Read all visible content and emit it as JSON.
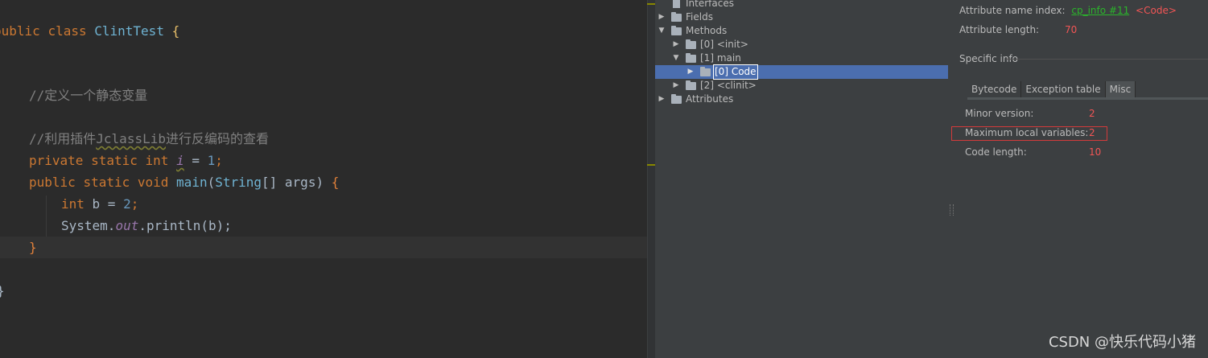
{
  "editor": {
    "lines": {
      "l1_kw1": "public",
      "l1_kw2": "class",
      "l1_cls": "ClintTest",
      "l1_brace": "{",
      "l2_comment": "//定义一个静态变量",
      "l3_comment_a": "//利用插件",
      "l3_comment_b": "JclassLib",
      "l3_comment_c": "进行反编码的查看",
      "l4_kw1": "private",
      "l4_kw2": "static",
      "l4_kw3": "int",
      "l4_var": "i",
      "l4_eq": " = ",
      "l4_num": "1",
      "l4_semi": ";",
      "l5_kw1": "public",
      "l5_kw2": "static",
      "l5_kw3": "void",
      "l5_fn": "main",
      "l5_paren": "(",
      "l5_type": "String",
      "l5_args": "[] args)",
      "l5_brace": "{",
      "l6_kw": "int",
      "l6_rest": " b = ",
      "l6_num": "2",
      "l6_semi": ";",
      "l7_sys": "System.",
      "l7_out": "out",
      "l7_call": ".println(b);",
      "l8_brace": "}",
      "l9_brace": "}"
    }
  },
  "tree": {
    "items": [
      {
        "label": "Interfaces"
      },
      {
        "label": "Fields"
      },
      {
        "label": "Methods"
      },
      {
        "label": "[0] <init>"
      },
      {
        "label": "[1] main"
      },
      {
        "label": "[0] Code"
      },
      {
        "label": "[2] <clinit>"
      },
      {
        "label": "Attributes"
      }
    ]
  },
  "details": {
    "attr_name_label": "Attribute name index:",
    "attr_name_link": "cp_info #11",
    "attr_name_value": "<Code>",
    "attr_length_label": "Attribute length:",
    "attr_length_value": "70",
    "specific_info": "Specific info",
    "tabs": [
      {
        "label": "Bytecode"
      },
      {
        "label": "Exception table"
      },
      {
        "label": "Misc"
      }
    ],
    "minor_version_label": "Minor version:",
    "minor_version_value": "2",
    "max_locals_label": "Maximum local variables:",
    "max_locals_value": "2",
    "code_length_label": "Code length:",
    "code_length_value": "10"
  },
  "watermark": "CSDN @快乐代码小猪",
  "colors": {
    "editor_bg": "#2b2b2b",
    "panel_bg": "#3c3f41",
    "selection": "#4b6eaf",
    "value_red": "#f25555",
    "link_green": "#2bb52b"
  }
}
